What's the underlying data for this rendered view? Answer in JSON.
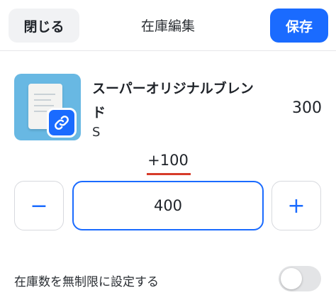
{
  "header": {
    "close_label": "閉じる",
    "title": "在庫編集",
    "save_label": "保存"
  },
  "product": {
    "name": "スーパーオリジナルブレンド",
    "variant": "S",
    "current_stock": "300"
  },
  "adjust": {
    "delta": "+100",
    "quantity": "400",
    "minus_symbol": "−",
    "plus_symbol": "+"
  },
  "settings": {
    "unlimited_label": "在庫数を無制限に設定する",
    "unlimited_enabled": false
  },
  "colors": {
    "accent": "#1a6bff",
    "delta_underline": "#d63b2a",
    "thumbnail_bg": "#68b8e3"
  },
  "icons": {
    "product_badge": "link-icon"
  }
}
